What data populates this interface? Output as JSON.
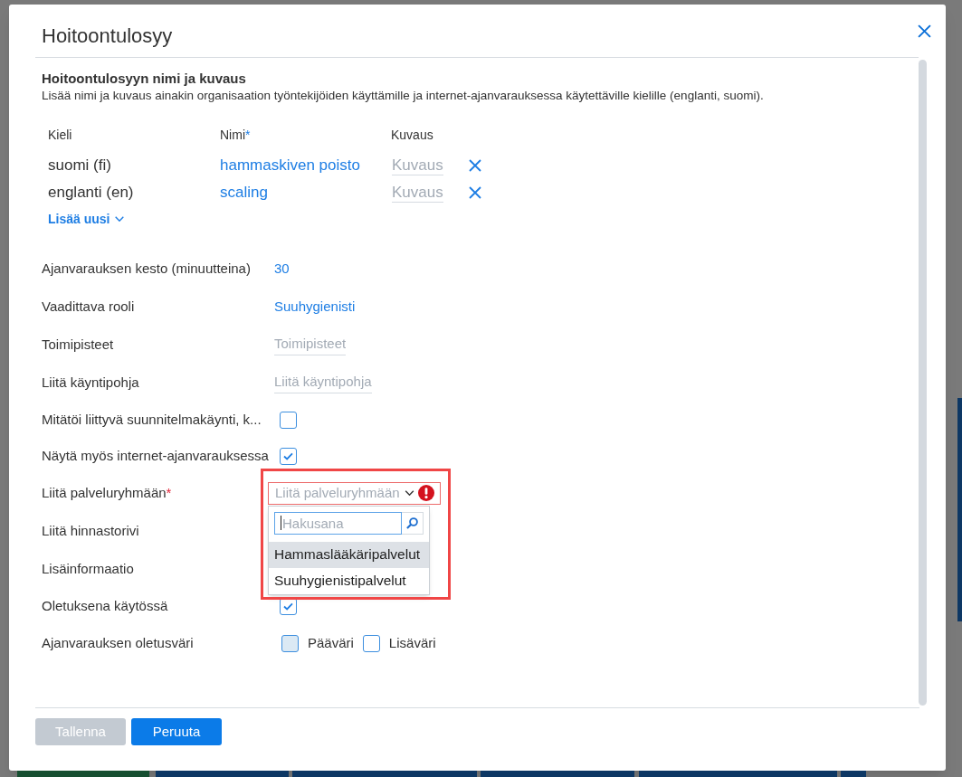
{
  "dialog": {
    "title": "Hoitoontulosyy"
  },
  "names_section": {
    "heading": "Hoitoontulosyyn nimi ja kuvaus",
    "description": "Lisää nimi ja kuvaus ainakin organisaation työntekijöiden käyttämille ja internet-ajanvarauksessa käytettäville kielille (englanti, suomi).",
    "columns": [
      {
        "label": "Kieli"
      },
      {
        "label": "Nimi",
        "required_mark": "*"
      },
      {
        "label": "Kuvaus"
      }
    ],
    "rows": [
      {
        "language": "suomi (fi)",
        "name": "hammaskiven poisto",
        "description_placeholder": "Kuvaus"
      },
      {
        "language": "englanti (en)",
        "name": "scaling",
        "description_placeholder": "Kuvaus"
      }
    ],
    "add_link": "Lisää uusi"
  },
  "fields": [
    {
      "kind": "value",
      "label": "Ajanvarauksen kesto (minuutteina)",
      "value": "30"
    },
    {
      "kind": "value",
      "label": "Vaadittava rooli",
      "value": "Suuhygienisti"
    },
    {
      "kind": "input",
      "label": "Toimipisteet",
      "placeholder": "Toimipisteet"
    },
    {
      "kind": "input",
      "label": "Liitä käyntipohja",
      "placeholder": "Liitä käyntipohja"
    },
    {
      "kind": "checkbox",
      "label": "Mitätöi liittyvä suunnitelmakäynti, k...",
      "checked": false
    },
    {
      "kind": "checkbox",
      "label": "Näytä myös internet-ajanvarauksessa",
      "checked": true
    },
    {
      "kind": "select",
      "label": "Liitä palveluryhmään",
      "required_mark": "*",
      "placeholder": "Liitä palveluryhmään",
      "error": true,
      "expanded": true,
      "search_placeholder": "Hakusana",
      "options": [
        {
          "label": "Hammaslääkäripalvelut",
          "selected": true
        },
        {
          "label": "Suuhygienistipalvelut",
          "selected": false
        }
      ]
    },
    {
      "kind": "label",
      "label": "Liitä hinnastorivi"
    },
    {
      "kind": "label",
      "label": "Lisäinformaatio"
    },
    {
      "kind": "checkbox",
      "label": "Oletuksena käytössä",
      "checked": true
    },
    {
      "kind": "colors",
      "label": "Ajanvarauksen oletusväri",
      "options": [
        {
          "label": "Pääväri",
          "color": "#dbe9f4"
        },
        {
          "label": "Lisäväri",
          "color": "#ffffff"
        }
      ]
    }
  ],
  "buttons": [
    {
      "label": "Tallenna",
      "disabled": true
    },
    {
      "label": "Peruuta",
      "disabled": false
    }
  ]
}
